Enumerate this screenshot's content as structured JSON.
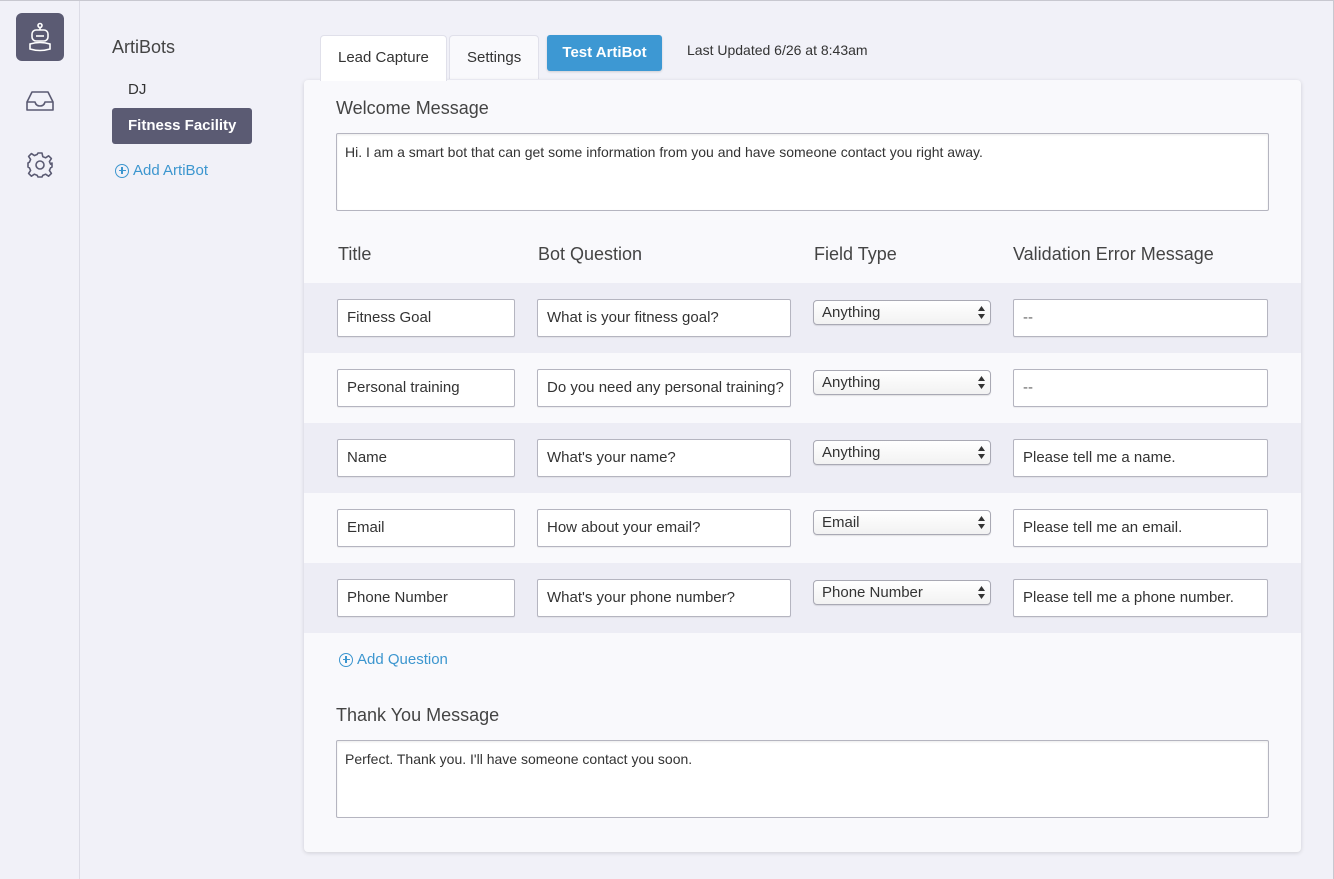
{
  "nav": {
    "items": [
      {
        "icon": "bot-icon",
        "active": true
      },
      {
        "icon": "inbox-icon",
        "active": false
      },
      {
        "icon": "gear-icon",
        "active": false
      }
    ]
  },
  "botlist": {
    "title": "ArtiBots",
    "items": [
      {
        "label": "DJ",
        "active": false
      },
      {
        "label": "Fitness Facility",
        "active": true
      }
    ],
    "add_label": "Add ArtiBot"
  },
  "tabs": [
    {
      "label": "Lead Capture",
      "active": true
    },
    {
      "label": "Settings",
      "active": false
    }
  ],
  "test_button": "Test ArtiBot",
  "last_updated": "Last Updated 6/26 at 8:43am",
  "welcome": {
    "label": "Welcome Message",
    "text": "Hi. I am a smart bot that can get some information from you and have someone contact you right away."
  },
  "columns": {
    "title": "Title",
    "question": "Bot Question",
    "field_type": "Field Type",
    "validation": "Validation Error Message"
  },
  "questions": [
    {
      "title": "Fitness Goal",
      "question": "What is your fitness goal?",
      "field_type": "Anything",
      "validation": "--"
    },
    {
      "title": "Personal training",
      "question": "Do you need any personal training?",
      "field_type": "Anything",
      "validation": "--"
    },
    {
      "title": "Name",
      "question": "What's your name?",
      "field_type": "Anything",
      "validation": "Please tell me a name."
    },
    {
      "title": "Email",
      "question": "How about your email?",
      "field_type": "Email",
      "validation": "Please tell me an email."
    },
    {
      "title": "Phone Number",
      "question": "What's your phone number?",
      "field_type": "Phone Number",
      "validation": "Please tell me a phone number."
    }
  ],
  "add_question_label": "Add Question",
  "thank_you": {
    "label": "Thank You Message",
    "text": "Perfect. Thank you. I'll have someone contact you soon."
  },
  "colors": {
    "accent": "#3d98d3",
    "nav_active": "#5b5b73",
    "link": "#3c96cf"
  }
}
